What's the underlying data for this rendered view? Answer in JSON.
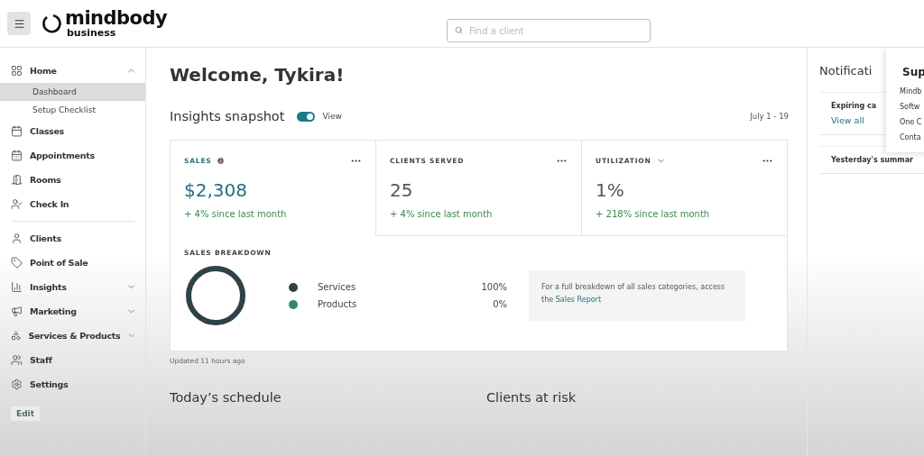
{
  "header": {
    "logo_name": "mindbody",
    "logo_sub": "business",
    "search": {
      "placeholder": "Find a client"
    }
  },
  "sidebar": {
    "groups": [
      [
        {
          "label": "Home",
          "expanded": true,
          "children": [
            {
              "label": "Dashboard",
              "selected": true
            },
            {
              "label": "Setup Checklist",
              "selected": false
            }
          ]
        },
        {
          "label": "Classes"
        },
        {
          "label": "Appointments"
        },
        {
          "label": "Rooms"
        },
        {
          "label": "Check In"
        }
      ],
      [
        {
          "label": "Clients"
        },
        {
          "label": "Point of Sale"
        },
        {
          "label": "Insights",
          "expanded": false
        },
        {
          "label": "Marketing",
          "expanded": false
        },
        {
          "label": "Services & Products",
          "expanded": false
        },
        {
          "label": "Staff"
        },
        {
          "label": "Settings"
        }
      ]
    ],
    "edit": "Edit"
  },
  "main": {
    "welcome": "Welcome, Tykira!",
    "snapshot": {
      "title": "Insights snapshot",
      "toggle": {
        "label": "View",
        "on": true
      },
      "date_range": "July 1 - 19"
    },
    "metrics": [
      {
        "kind": "info",
        "title": "SALES",
        "value": "$2,308",
        "change": "+ 4% since last month",
        "selected": true
      },
      {
        "kind": "plain",
        "title": "CLIENTS SERVED",
        "value": "25",
        "change": "+ 4% since last month",
        "selected": false
      },
      {
        "kind": "dropdown",
        "title": "UTILIZATION",
        "value": "1%",
        "change": "+ 218% since last month",
        "selected": false
      }
    ],
    "breakdown": {
      "title": "SALES BREAKDOWN",
      "legend": [
        {
          "label": "Services",
          "value": "100%",
          "color": "#2f4249"
        },
        {
          "label": "Products",
          "value": "0%",
          "color": "#2e8a72"
        }
      ],
      "note": "For a full breakdown of all sales categories, access the",
      "note_link": "Sales Report"
    },
    "updated": "Updated 11 hours ago",
    "sections": [
      "Today’s schedule",
      "Clients at risk"
    ]
  },
  "notifications": {
    "title": "Notificati",
    "cards": [
      {
        "title": "Expiring ca",
        "link": "View all"
      },
      {
        "title": "Yesterday's summar"
      }
    ]
  },
  "support_popover": {
    "title": "Sup",
    "items": [
      "Mindb",
      "Softw",
      "One C",
      "Conta"
    ]
  }
}
